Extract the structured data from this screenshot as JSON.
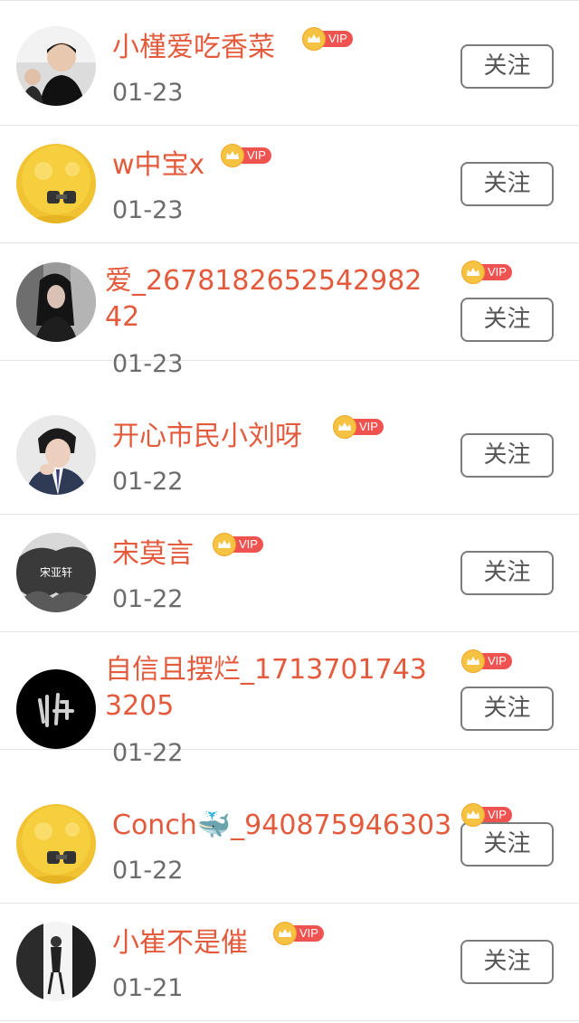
{
  "follow_label": "关注",
  "vip_label": "VIP",
  "colors": {
    "name": "#e35a3c",
    "date": "#6b6b6b",
    "vip_red": "#ef5350",
    "vip_gold": "#f5c242"
  },
  "users": [
    {
      "name": "小槿爱吃香菜",
      "date": "01-23"
    },
    {
      "name": "w中宝x",
      "date": "01-23"
    },
    {
      "name": "爱_2678182652542982​42",
      "date": "01-23"
    },
    {
      "name": "开心市民小刘呀",
      "date": "01-22"
    },
    {
      "name": "宋莫言",
      "date": "01-22"
    },
    {
      "name": "自信且摆烂_17137017433205",
      "date": "01-22"
    },
    {
      "name": "Conch🐳_940875946303",
      "date": "01-22"
    },
    {
      "name": "小崔不是催",
      "date": "01-21"
    }
  ]
}
